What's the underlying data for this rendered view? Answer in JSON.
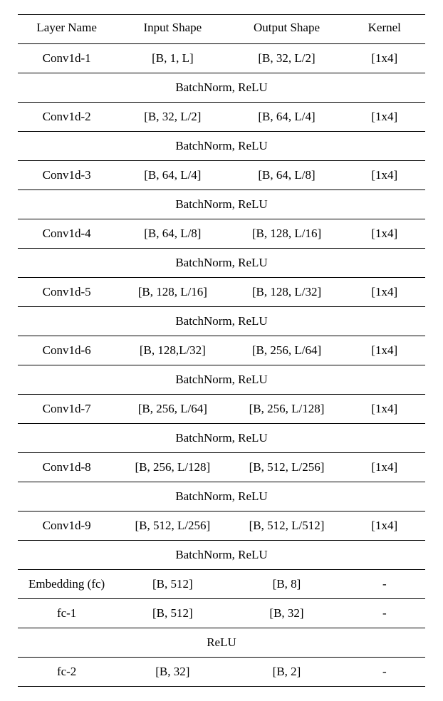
{
  "headers": {
    "layer": "Layer Name",
    "input": "Input Shape",
    "output": "Output Shape",
    "kernel": "Kernel"
  },
  "rows": [
    {
      "type": "data",
      "layer": "Conv1d-1",
      "input": "[B, 1, L]",
      "output": "[B, 32, L/2]",
      "kernel": "[1x4]"
    },
    {
      "type": "span",
      "text": "BatchNorm, ReLU"
    },
    {
      "type": "data",
      "layer": "Conv1d-2",
      "input": "[B, 32, L/2]",
      "output": "[B, 64, L/4]",
      "kernel": "[1x4]"
    },
    {
      "type": "span",
      "text": "BatchNorm, ReLU"
    },
    {
      "type": "data",
      "layer": "Conv1d-3",
      "input": "[B, 64, L/4]",
      "output": "[B, 64, L/8]",
      "kernel": "[1x4]"
    },
    {
      "type": "span",
      "text": "BatchNorm, ReLU"
    },
    {
      "type": "data",
      "layer": "Conv1d-4",
      "input": "[B, 64, L/8]",
      "output": "[B, 128, L/16]",
      "kernel": "[1x4]"
    },
    {
      "type": "span",
      "text": "BatchNorm, ReLU"
    },
    {
      "type": "data",
      "layer": "Conv1d-5",
      "input": "[B, 128, L/16]",
      "output": "[B, 128, L/32]",
      "kernel": "[1x4]"
    },
    {
      "type": "span",
      "text": "BatchNorm, ReLU"
    },
    {
      "type": "data",
      "layer": "Conv1d-6",
      "input": "[B, 128,L/32]",
      "output": "[B, 256, L/64]",
      "kernel": "[1x4]"
    },
    {
      "type": "span",
      "text": "BatchNorm, ReLU"
    },
    {
      "type": "data",
      "layer": "Conv1d-7",
      "input": "[B, 256, L/64]",
      "output": "[B, 256, L/128]",
      "kernel": "[1x4]"
    },
    {
      "type": "span",
      "text": "BatchNorm, ReLU"
    },
    {
      "type": "data",
      "layer": "Conv1d-8",
      "input": "[B, 256, L/128]",
      "output": "[B, 512, L/256]",
      "kernel": "[1x4]"
    },
    {
      "type": "span",
      "text": "BatchNorm, ReLU"
    },
    {
      "type": "data",
      "layer": "Conv1d-9",
      "input": "[B, 512, L/256]",
      "output": "[B, 512, L/512]",
      "kernel": "[1x4]"
    },
    {
      "type": "span",
      "text": "BatchNorm, ReLU"
    },
    {
      "type": "data",
      "layer": "Embedding (fc)",
      "input": "[B, 512]",
      "output": "[B, 8]",
      "kernel": "-"
    },
    {
      "type": "data",
      "layer": "fc-1",
      "input": "[B, 512]",
      "output": "[B, 32]",
      "kernel": "-"
    },
    {
      "type": "span",
      "text": "ReLU"
    },
    {
      "type": "data",
      "layer": "fc-2",
      "input": "[B, 32]",
      "output": "[B, 2]",
      "kernel": "-"
    }
  ]
}
